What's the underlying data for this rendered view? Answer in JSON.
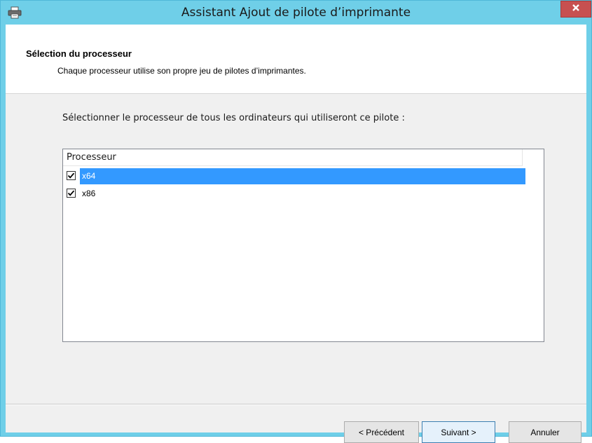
{
  "window": {
    "title": "Assistant Ajout de pilote d’imprimante",
    "close_glyph": "x"
  },
  "header": {
    "title": "Sélection du processeur",
    "subtitle": "Chaque processeur utilise son propre jeu de pilotes d’imprimantes."
  },
  "prompt": "Sélectionner le processeur de tous les ordinateurs qui utiliseront ce pilote :",
  "list": {
    "column_header": "Processeur",
    "rows": [
      {
        "label": "x64",
        "checked": true,
        "selected": true
      },
      {
        "label": "x86",
        "checked": true,
        "selected": false
      }
    ]
  },
  "buttons": {
    "back": "< Précédent",
    "next": "Suivant >",
    "cancel": "Annuler"
  },
  "colors": {
    "titlebar": "#6fcfe8",
    "close": "#c75050",
    "selection": "#3399ff"
  },
  "icons": {
    "app": "printer-icon",
    "check": "checkmark-icon"
  }
}
